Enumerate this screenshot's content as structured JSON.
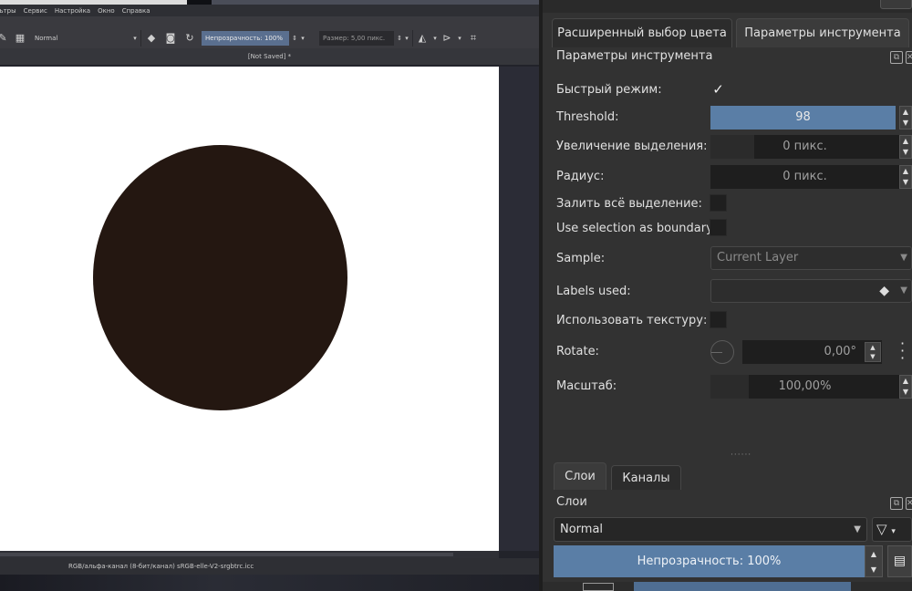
{
  "canvas_window": {
    "menu": [
      "льтры",
      "Сервис",
      "Настройка",
      "Окно",
      "Справка"
    ],
    "toolbar": {
      "blend_mode": "Normal",
      "opacity": "Непрозрачность: 100%",
      "size": "Размер: 5,00 пикс."
    },
    "document_title": "[Not Saved]  *",
    "status_text": "RGB/альфа-канал (8-бит/канал)  sRGB-elle-V2-srgbtrc.icc",
    "circle_color": "#241711"
  },
  "dock": {
    "tabs": [
      "Расширенный выбор цвета",
      "Параметры инструмента"
    ],
    "panel_title": "Параметры инструмента",
    "options": {
      "fast_mode_label": "Быстрый режим:",
      "fast_mode_checked": "✓",
      "threshold_label": "Threshold:",
      "threshold_value": "98",
      "grow_label": "Увеличение выделения:",
      "grow_value": "0 пикс.",
      "radius_label": "Радиус:",
      "radius_value": "0 пикс.",
      "fill_selection_label": "Залить всё выделение:",
      "boundary_label": "Use selection as boundary:",
      "sample_label": "Sample:",
      "sample_value": "Current Layer",
      "labels_used_label": "Labels used:",
      "use_texture_label": "Использовать текстуру:",
      "rotate_label": "Rotate:",
      "rotate_value": "0,00°",
      "scale_label": "Масштаб:",
      "scale_value": "100,00%"
    },
    "layers_tabs": [
      "Слои",
      "Каналы"
    ],
    "layers_title": "Слои",
    "layers_blend": "Normal",
    "layers_opacity": "Непрозрачность:  100%"
  }
}
